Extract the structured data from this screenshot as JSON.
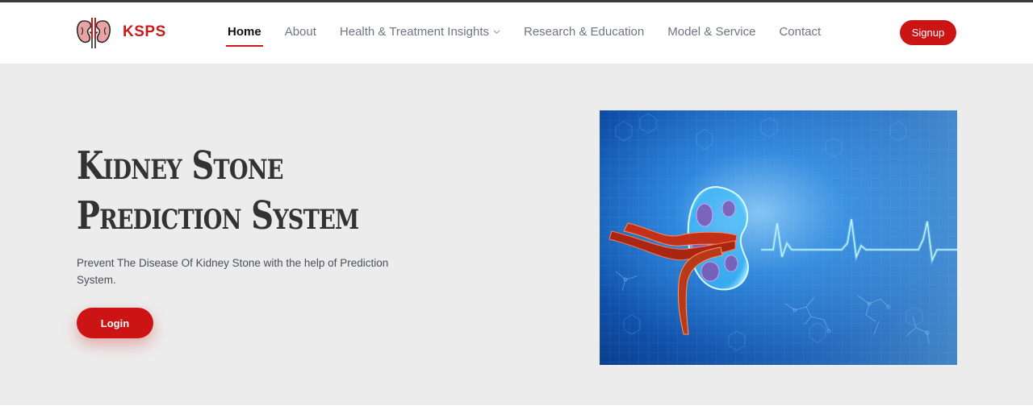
{
  "brand": {
    "name": "KSPS",
    "logo_icon": "kidney-icon",
    "accent_color": "#cc1414"
  },
  "nav": {
    "items": [
      {
        "label": "Home",
        "active": true
      },
      {
        "label": "About",
        "active": false
      },
      {
        "label": "Health & Treatment Insights",
        "active": false,
        "has_dropdown": true
      },
      {
        "label": "Research & Education",
        "active": false
      },
      {
        "label": "Model & Service",
        "active": false
      },
      {
        "label": "Contact",
        "active": false
      }
    ],
    "signup_label": "Signup"
  },
  "hero": {
    "title_line1": "Kidney Stone",
    "title_line2": "Prediction System",
    "description": "Prevent The Disease Of Kidney Stone with the help of Prediction System.",
    "login_label": "Login",
    "image_icon": "kidney-heartbeat-illustration"
  }
}
